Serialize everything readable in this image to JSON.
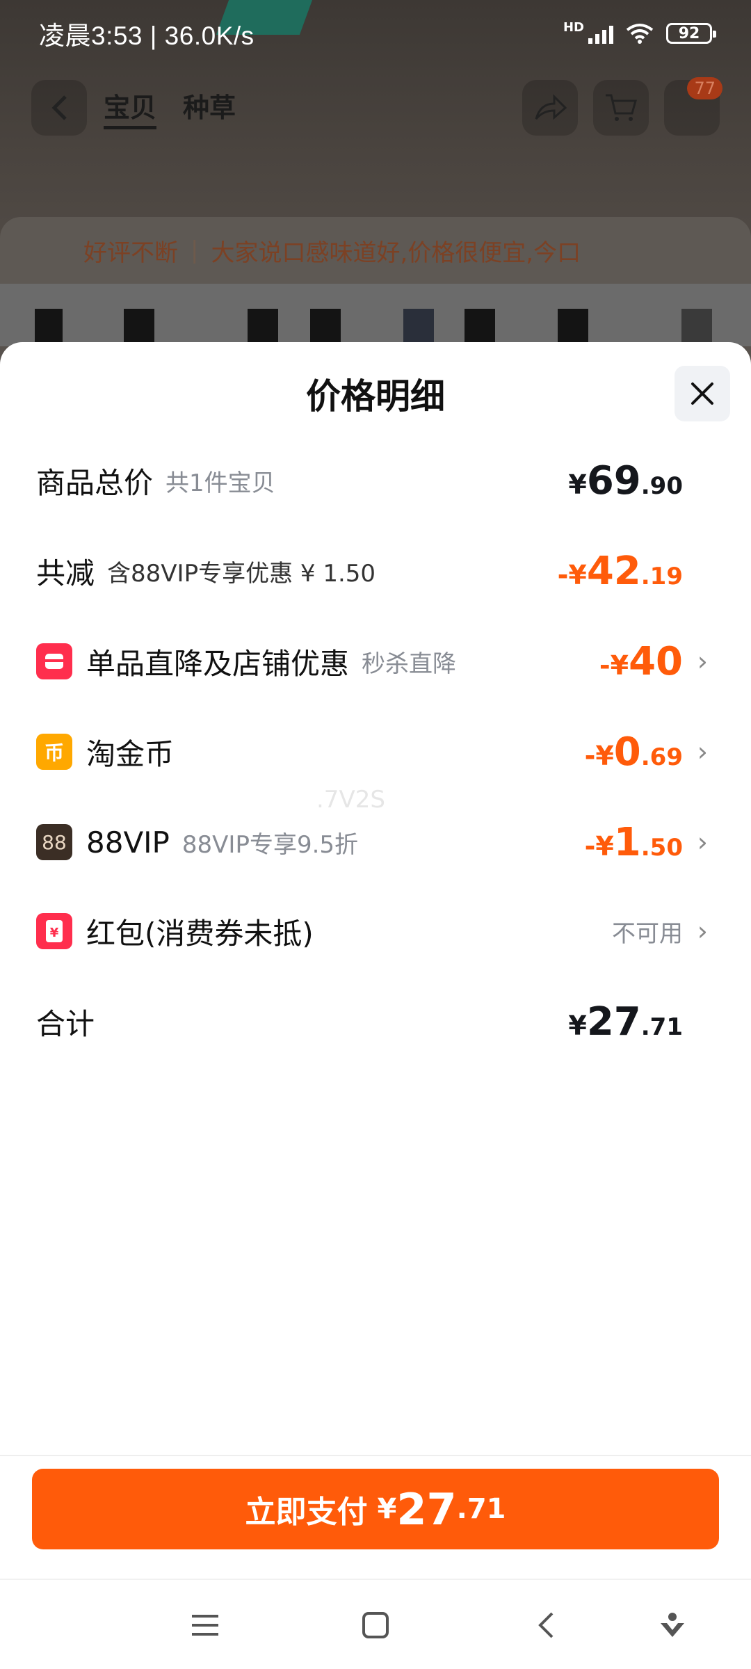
{
  "status_bar": {
    "time_speed": "凌晨3:53 | 36.0K/s",
    "battery": "92",
    "network": "HD"
  },
  "background_page": {
    "tabs": [
      "宝贝",
      "种草"
    ],
    "cart_badge": "77",
    "review_prefix": "好评不断",
    "review_text": "大家说口感味道好,价格很便宜,今口"
  },
  "sheet": {
    "title": "价格明细",
    "watermark": ".7V2S",
    "rows": {
      "total": {
        "label": "商品总价",
        "sub": "共1件宝贝",
        "yen": "¥",
        "int": "69",
        "dec": ".90"
      },
      "reduced": {
        "label": "共减",
        "sub": "含88VIP专享优惠 ¥ 1.50",
        "yen": "-¥",
        "int": "42",
        "dec": ".19"
      },
      "discount": {
        "label": "单品直降及店铺优惠",
        "sub": "秒杀直降",
        "yen": "-¥",
        "int": "40",
        "dec": ""
      },
      "coins": {
        "label": "淘金币",
        "sub": "",
        "icon_text": "币",
        "yen": "-¥",
        "int": "0",
        "dec": ".69"
      },
      "vip": {
        "label": "88VIP",
        "sub": "88VIP专享9.5折",
        "icon_text": "88",
        "yen": "-¥",
        "int": "1",
        "dec": ".50"
      },
      "redpacket": {
        "label": "红包(消费券未抵)",
        "icon_text": "¥",
        "status": "不可用"
      },
      "sum": {
        "label": "合计",
        "yen": "¥",
        "int": "27",
        "dec": ".71"
      }
    }
  },
  "pay_button": {
    "label": "立即支付",
    "yen": "¥",
    "int": "27",
    "dec": ".71"
  },
  "colors": {
    "accent": "#ff5b0a",
    "shop_icon": "#ff2e4d",
    "coin_icon": "#ffa800",
    "vip_icon": "#3b2e25"
  },
  "icons": {
    "close": "close-icon",
    "shop": "shop-icon",
    "coin": "coin-icon",
    "vip": "vip-icon",
    "redpacket": "red-packet-icon",
    "chevron": "chevron-right-icon"
  }
}
